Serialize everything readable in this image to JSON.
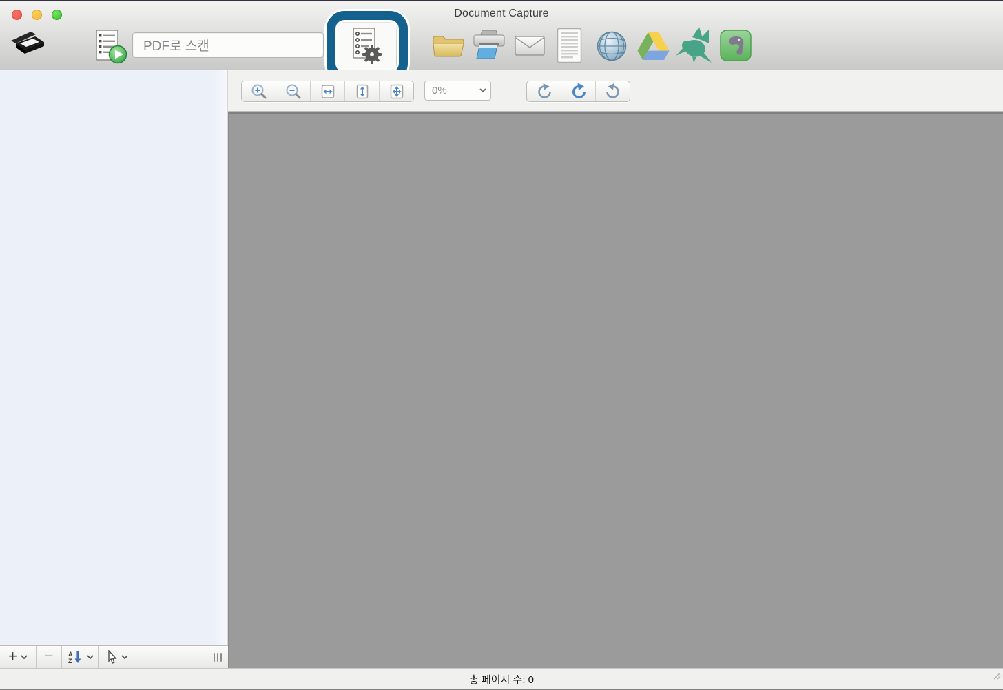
{
  "window": {
    "title": "Document Capture"
  },
  "traffic_lights": {
    "close_color": "#f2564d",
    "minimize_color": "#f6bc3e",
    "zoom_color": "#3ec42e"
  },
  "toolbar": {
    "app_icon": "scanner-icon",
    "scan_button_icon": "scan-job-play-icon",
    "profile_select": {
      "value": "PDF로 스캔"
    },
    "highlighted_button": {
      "icon": "job-settings-gear-icon",
      "annotation": "blue-highlight-ring",
      "highlight_color": "#15618d"
    },
    "destination_icons": [
      "folder-icon",
      "printer-icon",
      "mail-icon",
      "document-icon",
      "globe-icon",
      "google-drive-icon",
      "hummingbird-icon",
      "evernote-icon"
    ]
  },
  "preview_toolbar": {
    "buttons": [
      "zoom-in",
      "zoom-out",
      "fit-width",
      "fit-height",
      "fit-page",
      "rotate-left",
      "rotate-180",
      "rotate-right"
    ],
    "zoom_select": {
      "value": "0%"
    }
  },
  "sidebar": {
    "items": [],
    "toolbar": {
      "add_label": "+",
      "remove_label": "−",
      "buttons": [
        "add-item",
        "remove-item",
        "sort-items",
        "select-tool"
      ]
    }
  },
  "status_bar": {
    "total_pages_text": "총 페이지 수: 0"
  },
  "colors": {
    "preview_background": "#9b9b9b",
    "sidebar_background": "#ecf1f9",
    "toolbar_strip_background": "#f1f1ef",
    "highlight_blue": "#15618d"
  }
}
